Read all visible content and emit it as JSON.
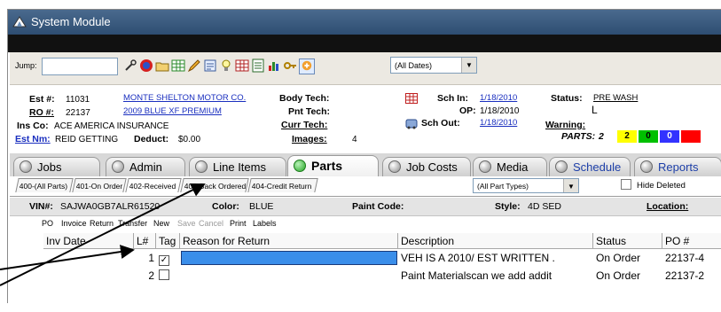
{
  "window": {
    "title": "System Module"
  },
  "toolbar": {
    "jump_label": "Jump:",
    "jump_value": "",
    "dates_select": "(All Dates)",
    "icons": [
      "tools-icon",
      "globe-icon",
      "open-folder-icon",
      "grid-calendar-icon",
      "pencil-icon",
      "report-icon",
      "bulb-icon",
      "spreadsheet-icon",
      "list-icon",
      "chart-icon",
      "key-icon",
      "help-icon"
    ]
  },
  "estimate": {
    "est_label": "Est #:",
    "est_value": "11031",
    "owner_link": "MONTE SHELTON MOTOR CO.",
    "ro_label": "RO #:",
    "ro_value": "22137",
    "vehicle_link": "2009 BLUE XF PREMIUM",
    "ins_label": "Ins Co:",
    "ins_value": "ACE AMERICA INSURANCE",
    "estnm_label": "Est Nm:",
    "estnm_value": "REID GETTING",
    "deduct_label": "Deduct:",
    "deduct_value": "$0.00",
    "body_tech_label": "Body Tech:",
    "pnt_tech_label": "Pnt Tech:",
    "curr_tech_label": "Curr Tech:",
    "images_label": "Images:",
    "images_value": "4",
    "sch_in_label": "Sch In:",
    "sch_in_value": "1/18/2010",
    "op_label": "OP:",
    "op_value": "1/18/2010",
    "sch_out_label": "Sch Out:",
    "sch_out_value": "1/18/2010",
    "status_label": "Status:",
    "status_value": "PRE WASH",
    "status_extra": "L",
    "warning_label": "Warning:",
    "parts_label": "PARTS:",
    "parts_value": "2",
    "parts_counts": [
      {
        "value": "2",
        "color": "#ffff00",
        "text_color": "#000000"
      },
      {
        "value": "0",
        "color": "#00c000",
        "text_color": "#000000"
      },
      {
        "value": "0",
        "color": "#3333ff",
        "text_color": "#ffffff"
      },
      {
        "value": "",
        "color": "#ff0000",
        "text_color": "#ffffff"
      }
    ]
  },
  "tabs": [
    {
      "label": "Jobs"
    },
    {
      "label": "Admin"
    },
    {
      "label": "Line Items"
    },
    {
      "label": "Parts",
      "active": true
    },
    {
      "label": "Job Costs"
    },
    {
      "label": "Media"
    },
    {
      "label": "Schedule"
    },
    {
      "label": "Reports"
    }
  ],
  "subtabs": [
    "400-(All Parts)",
    "401-On Order",
    "402-Received",
    "403-Back Ordered",
    "404-Credit Return"
  ],
  "part_types_select": "(All Part Types)",
  "hide_deleted_label": "Hide Deleted",
  "vehicle": {
    "vin_label": "VIN#:",
    "vin_value": "SAJWA0GB7ALR61520",
    "color_label": "Color:",
    "color_value": "BLUE",
    "paint_label": "Paint Code:",
    "style_label": "Style:",
    "style_value": "4D SED",
    "location_label": "Location:"
  },
  "actions": [
    {
      "label": "PO",
      "enabled": true
    },
    {
      "label": "Invoice",
      "enabled": true
    },
    {
      "label": "Return",
      "enabled": true
    },
    {
      "label": "Transfer",
      "enabled": true
    },
    {
      "label": "New",
      "enabled": true
    },
    {
      "label": "Save",
      "enabled": false
    },
    {
      "label": "Cancel",
      "enabled": false
    },
    {
      "label": "Print",
      "enabled": true
    },
    {
      "label": "Labels",
      "enabled": true
    }
  ],
  "grid": {
    "columns": [
      "Inv Date",
      "L#",
      "Tag",
      "Reason for Return",
      "Description",
      "Status",
      "PO #"
    ],
    "rows": [
      {
        "inv_date": "",
        "line": "1",
        "tag": true,
        "reason": "",
        "description": "VEH IS A 2010/ EST WRITTEN .",
        "status": "On Order",
        "po": "22137-4"
      },
      {
        "inv_date": "",
        "line": "2",
        "tag": false,
        "reason": "",
        "description": "Paint Materialscan we add addit",
        "status": "On Order",
        "po": "22137-2"
      }
    ]
  },
  "colors": {
    "titlebar": "#3a5a80",
    "selection": "#3a8eea",
    "active_tab_dot": "#24a524"
  }
}
